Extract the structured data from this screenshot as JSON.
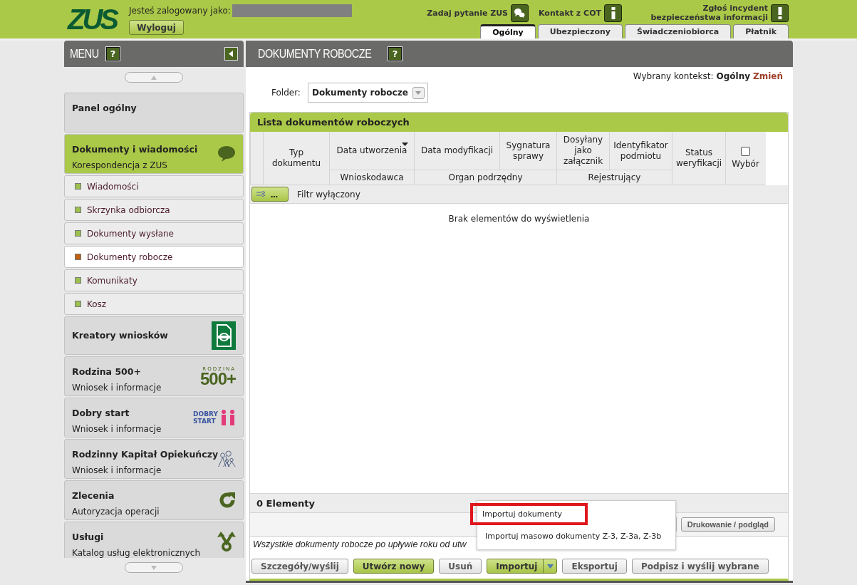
{
  "header": {
    "logo_text": "ZUS",
    "login_label": "Jesteś zalogowany jako:",
    "logout": "Wyloguj",
    "links": [
      {
        "label": "Zadaj pytanie ZUS",
        "kind": "chat"
      },
      {
        "label": "Kontakt z COT",
        "kind": "info"
      },
      {
        "label": "Zgłoś incydent bezpieczeństwa informacji",
        "kind": "alert"
      }
    ],
    "tabs": [
      {
        "label": "Ogólny",
        "selected": true
      },
      {
        "label": "Ubezpieczony",
        "selected": false
      },
      {
        "label": "Świadczeniobiorca",
        "selected": false
      },
      {
        "label": "Płatnik",
        "selected": false
      }
    ]
  },
  "menu": {
    "title": "MENU",
    "help": "?",
    "items": [
      {
        "kind": "plain",
        "title": "Panel ogólny",
        "selected": false
      },
      {
        "kind": "speech",
        "title": "Dokumenty i wiadomości",
        "subtitle": "Korespondencja z ZUS",
        "selected": true
      },
      {
        "kind": "sub",
        "title": "Wiadomości",
        "selected": false
      },
      {
        "kind": "sub",
        "title": "Skrzynka odbiorcza",
        "selected": false
      },
      {
        "kind": "sub",
        "title": "Dokumenty wysłane",
        "selected": false
      },
      {
        "kind": "sub",
        "title": "Dokumenty robocze",
        "selected": true
      },
      {
        "kind": "sub",
        "title": "Komunikaty",
        "selected": false
      },
      {
        "kind": "sub",
        "title": "Kosz",
        "selected": false
      },
      {
        "kind": "document",
        "title": "Kreatory wniosków",
        "selected": false
      },
      {
        "kind": "rodzina",
        "title": "Rodzina 500+",
        "subtitle": "Wniosek i informacje",
        "logo_text": [
          "RODZINA",
          "500+"
        ],
        "selected": false
      },
      {
        "kind": "dobrystart",
        "title": "Dobry start",
        "subtitle": "Wniosek i informacje",
        "logo_text": [
          "DOBRY",
          "START"
        ],
        "selected": false
      },
      {
        "kind": "family",
        "title": "Rodzinny Kapitał Opiekuńczy",
        "subtitle": "Wniosek i informacje",
        "selected": false
      },
      {
        "kind": "refresh",
        "title": "Zlecenia",
        "subtitle": "Autoryzacja operacji",
        "selected": false
      },
      {
        "kind": "branch",
        "title": "Usługi",
        "subtitle": "Katalog usług elektronicznych",
        "selected": false
      }
    ]
  },
  "content": {
    "title": "DOKUMENTY ROBOCZE",
    "help": "?",
    "context_label": "Wybrany kontekst:",
    "context_value": "Ogólny",
    "context_link": "Zmień",
    "folder_label": "Folder:",
    "folder_value": "Dokumenty robocze",
    "list": {
      "title": "Lista dokumentów roboczych",
      "columns": [
        {
          "label": "Typ dokumentu",
          "kind": "tall"
        },
        {
          "label": "Data utworzenia",
          "kind": "sorted"
        },
        {
          "label": "Data modyfikacji",
          "kind": "top"
        },
        {
          "label": "Sygnatura sprawy",
          "kind": "top"
        },
        {
          "label": "Dosyłany jako załącznik",
          "kind": "top"
        },
        {
          "label": "Identyfikator podmiotu",
          "kind": "top"
        },
        {
          "label": "Status weryfikacji",
          "kind": "tall"
        },
        {
          "label": "Wybór",
          "kind": "check",
          "checked": false
        }
      ],
      "subcolumns": [
        "Wnioskodawca",
        "Organ podrzędny",
        "Rejestrujący"
      ],
      "filter_button": "...",
      "filter_status": "Filtr wyłączony",
      "empty": "Brak elementów do wyświetlenia",
      "count": "0 Elementy",
      "print": "Drukowanie / podgląd",
      "note": "Wszystkie dokumenty robocze po upływie roku od utw",
      "buttons": [
        {
          "label": "Szczegóły/wyślij",
          "kind": "default"
        },
        {
          "label": "Utwórz nowy",
          "kind": "primary"
        },
        {
          "label": "Usuń",
          "kind": "default"
        },
        {
          "label": "Importuj",
          "kind": "split"
        },
        {
          "label": "Eksportuj",
          "kind": "default"
        },
        {
          "label": "Podpisz i wyślij wybrane",
          "kind": "default"
        }
      ],
      "dropdown": [
        {
          "label": "Importuj dokumenty",
          "highlighted": true
        },
        {
          "label": "Importuj masowo dokumenty Z-3, Z-3a, Z-3b",
          "highlighted": false
        }
      ]
    }
  }
}
